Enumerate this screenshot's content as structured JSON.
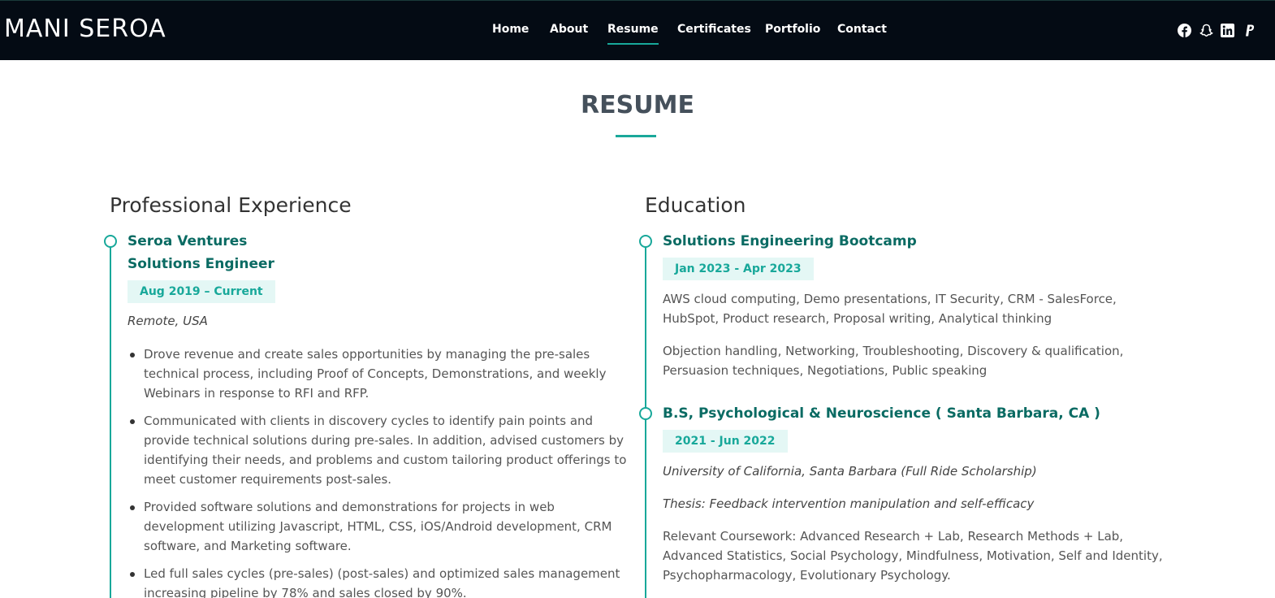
{
  "header": {
    "logo": "MANI SEROA",
    "nav": [
      {
        "label": "Home"
      },
      {
        "label": "About"
      },
      {
        "label": "Resume"
      },
      {
        "label": "Certificates"
      },
      {
        "label": "Portfolio"
      },
      {
        "label": "Contact"
      }
    ],
    "active_nav": "Resume",
    "social_icons": [
      "facebook-icon",
      "snapchat-icon",
      "linkedin-icon",
      "paypal-icon"
    ]
  },
  "colors": {
    "header_bg": "#040b14",
    "accent": "#18a89a",
    "item_title": "#0a6b63",
    "badge_bg": "#e4f7f5"
  },
  "section": {
    "title": "RESUME"
  },
  "experience": {
    "heading": "Professional Experience",
    "items": [
      {
        "company": "Seroa Ventures",
        "role": "Solutions Engineer",
        "dates": "Aug 2019 – Current",
        "location": "Remote, USA",
        "bullets": [
          "Drove revenue and create sales opportunities by managing the pre-sales technical process, including Proof of Concepts, Demonstrations, and weekly Webinars in response to RFI and RFP.",
          "Communicated with clients in discovery cycles to identify pain points and provide technical solutions during pre-sales. In addition, advised customers by identifying their needs, and problems and custom tailoring product offerings to meet customer requirements post-sales.",
          "Provided software solutions and demonstrations for projects in web development utilizing Javascript, HTML, CSS, iOS/Android development, CRM software, and Marketing software.",
          "Led full sales cycles (pre-sales) (post-sales) and optimized sales management increasing pipeline by 78% and sales closed by 90%."
        ]
      }
    ]
  },
  "education": {
    "heading": "Education",
    "items": [
      {
        "title": "Solutions Engineering Bootcamp",
        "dates": "Jan 2023 - Apr 2023",
        "paragraphs": [
          "AWS cloud computing, Demo presentations, IT Security, CRM - SalesForce, HubSpot, Product research, Proposal writing, Analytical thinking",
          "Objection handling, Networking, Troubleshooting, Discovery & qualification, Persuasion techniques, Negotiations, Public speaking"
        ]
      },
      {
        "title": "B.S, Psychological & Neuroscience ( Santa Barbara, CA )",
        "dates": "2021 - Jun 2022",
        "school": "University of California, Santa Barbara (Full Ride Scholarship)",
        "thesis": "Thesis: Feedback intervention manipulation and self-efficacy",
        "coursework": "Relevant Coursework: Advanced Research + Lab, Research Methods + Lab, Advanced Statistics, Social Psychology, Mindfulness, Motivation, Self and Identity, Psychopharmacology, Evolutionary Psychology."
      }
    ]
  }
}
